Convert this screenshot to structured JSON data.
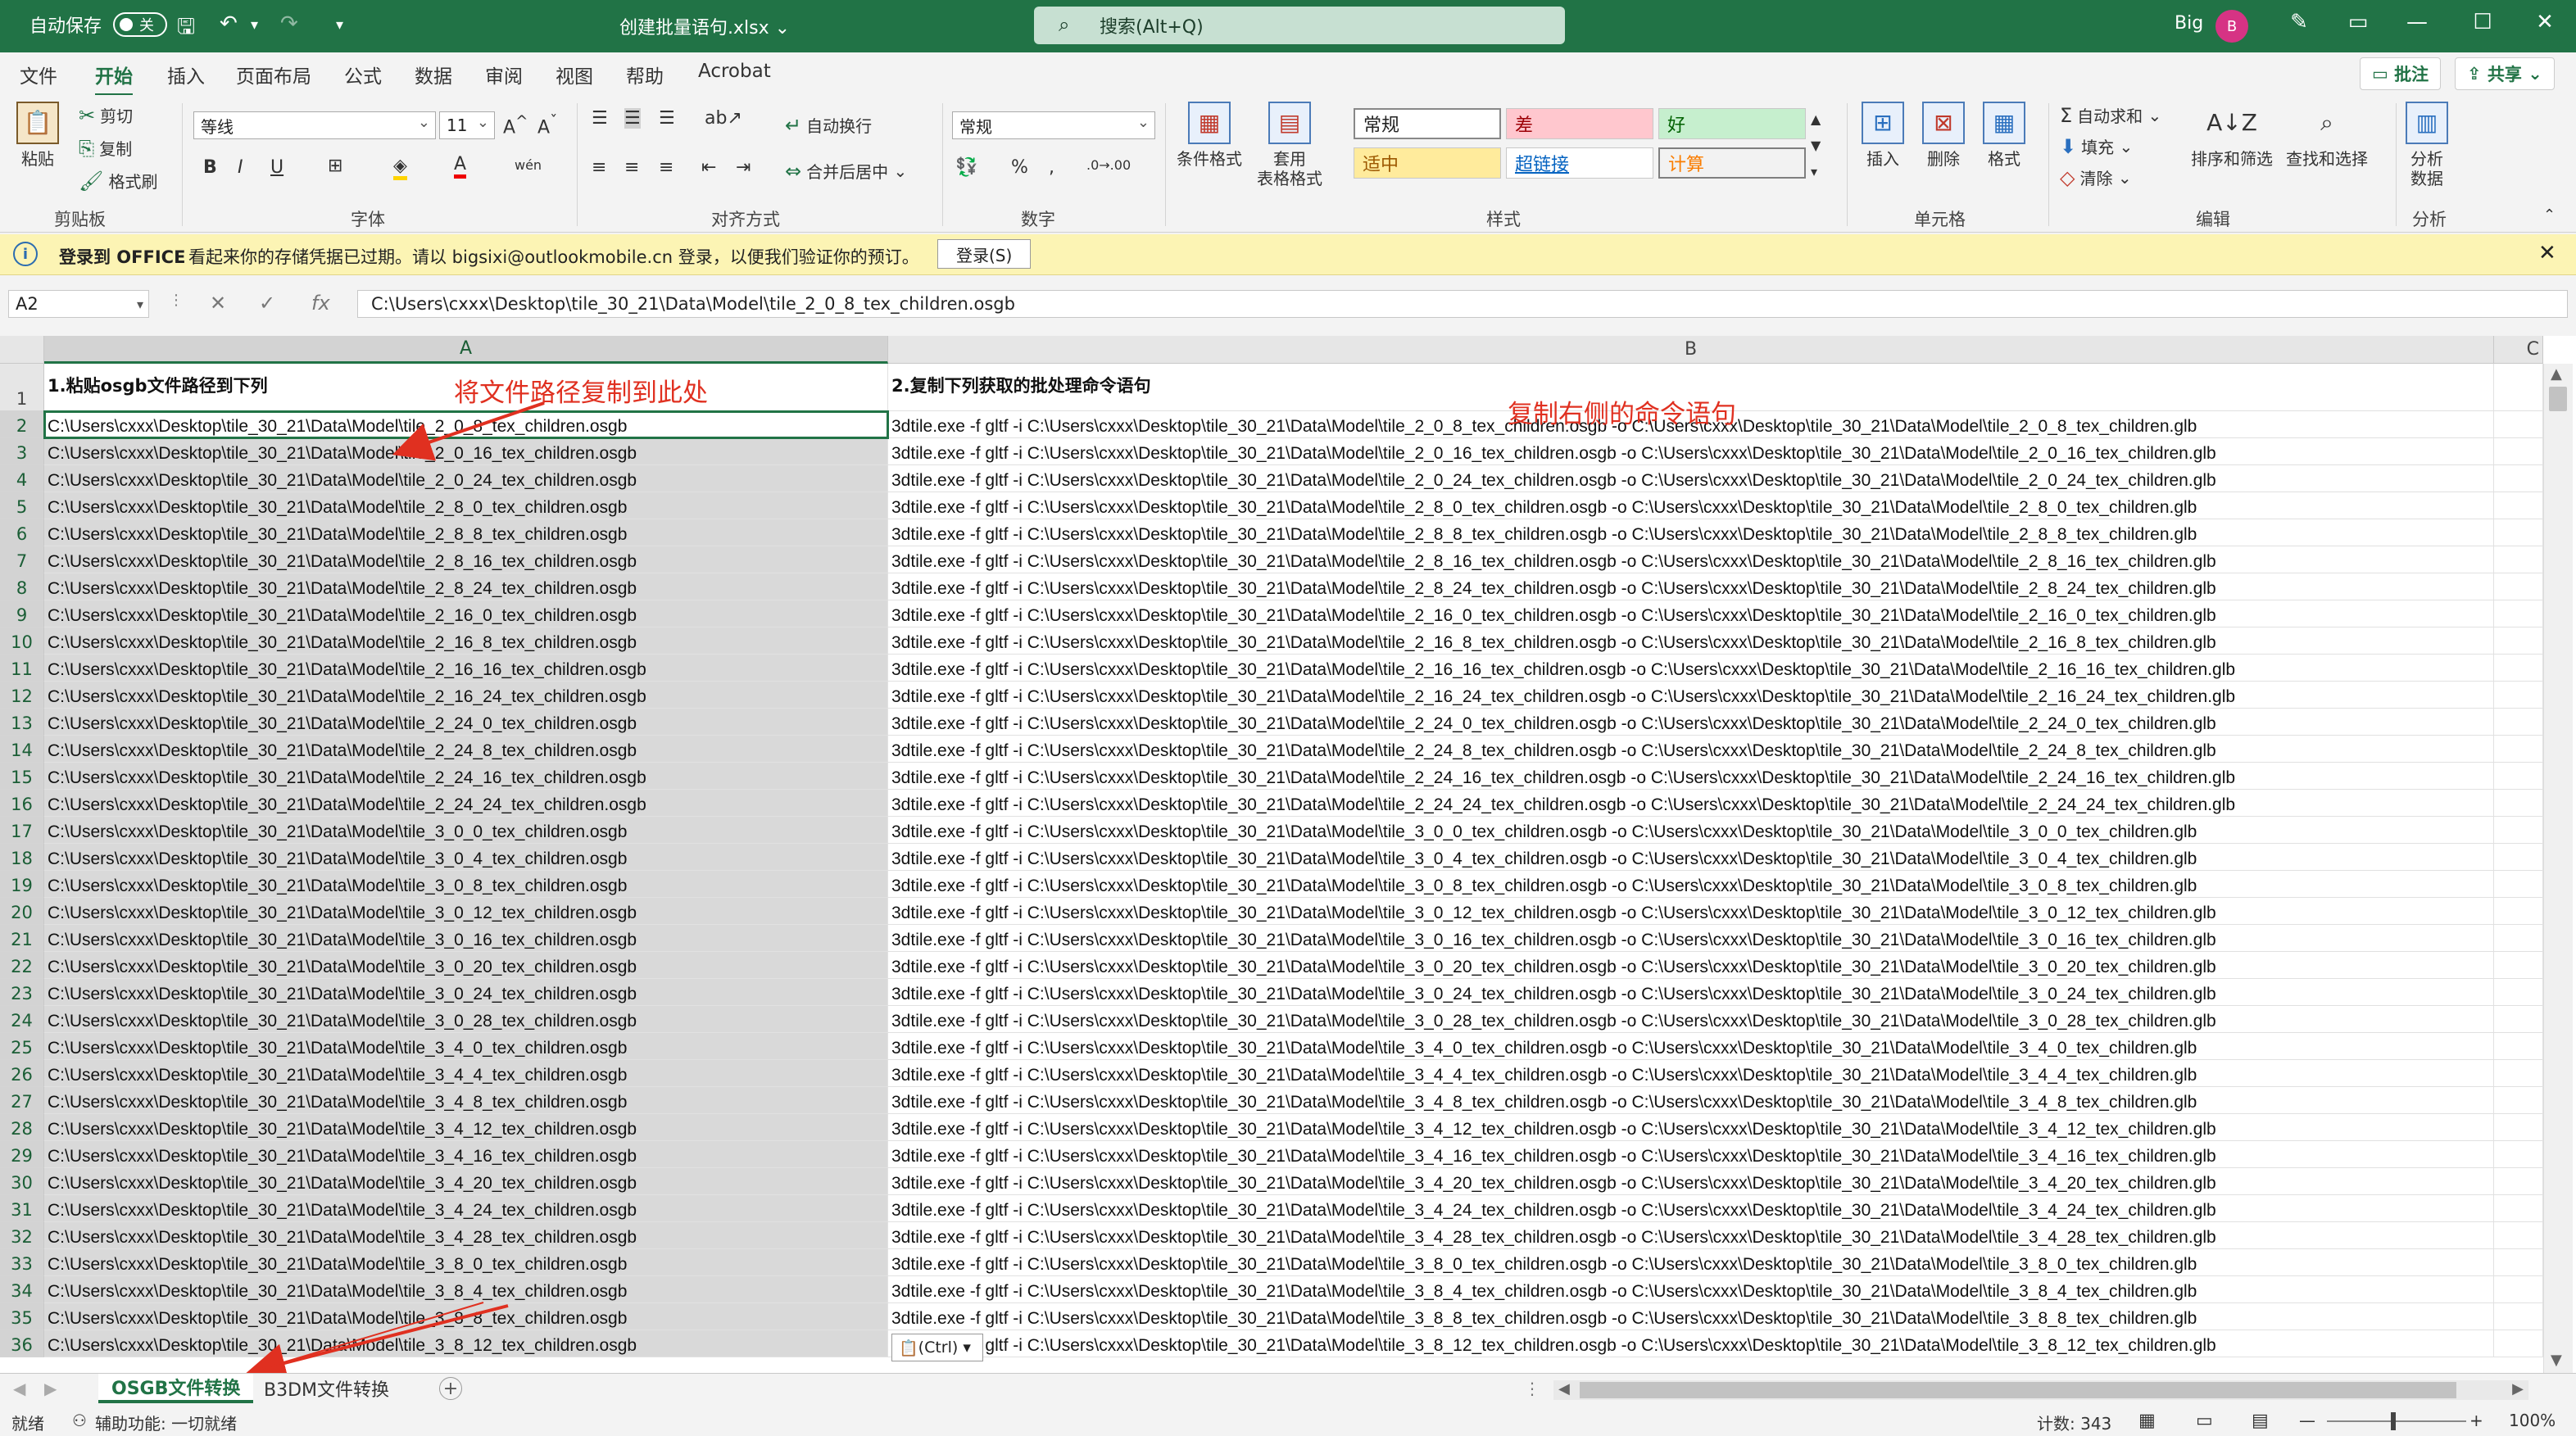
{
  "titlebar": {
    "autosave_label": "自动保存",
    "autosave_state": "关",
    "doc_title": "创建批量语句.xlsx",
    "search_placeholder": "搜索(Alt+Q)",
    "user_name": "Big",
    "avatar_initial": "B"
  },
  "menu": {
    "items": [
      "文件",
      "开始",
      "插入",
      "页面布局",
      "公式",
      "数据",
      "审阅",
      "视图",
      "帮助",
      "Acrobat"
    ],
    "comment_label": "批注",
    "share_label": "共享"
  },
  "ribbon": {
    "clipboard": {
      "paste": "粘贴",
      "cut": "剪切",
      "copy": "复制",
      "format_painter": "格式刷",
      "label": "剪贴板"
    },
    "font": {
      "name": "等线",
      "size": "11",
      "label": "字体",
      "bold": "B",
      "italic": "I",
      "underline": "U"
    },
    "alignment": {
      "wrap": "自动换行",
      "merge": "合并后居中",
      "label": "对齐方式"
    },
    "number": {
      "format": "常规",
      "label": "数字"
    },
    "styles": {
      "conditional": "条件格式",
      "table": "套用\n表格格式",
      "cells": [
        "常规",
        "差",
        "好",
        "适中",
        "超链接",
        "计算"
      ],
      "label": "样式"
    },
    "cells": {
      "insert": "插入",
      "delete": "删除",
      "format": "格式",
      "label": "单元格"
    },
    "editing": {
      "autosum": "自动求和",
      "fill": "填充",
      "clear": "清除",
      "sort": "排序和筛选",
      "find": "查找和选择",
      "label": "编辑"
    },
    "analysis": {
      "analyze": "分析\n数据",
      "label": "分析"
    }
  },
  "message": {
    "title": "登录到 OFFICE",
    "text": "看起来你的存储凭据已过期。请以 bigsixi@outlookmobile.cn 登录，以便我们验证你的预订。",
    "button": "登录(S)"
  },
  "formula_bar": {
    "name_box": "A2",
    "fx": "fx",
    "value": "C:\\Users\\cxxx\\Desktop\\tile_30_21\\Data\\Model\\tile_2_0_8_tex_children.osgb"
  },
  "grid": {
    "columns": [
      "A",
      "B",
      "C"
    ],
    "header_a": "1.粘贴osgb文件路径到下列",
    "header_b": "2.复制下列获取的批处理命令语句",
    "path_prefix": "C:\\Users\\cxxx\\Desktop\\tile_30_21\\Data\\Model\\",
    "tiles": [
      "2_0_8",
      "2_0_16",
      "2_0_24",
      "2_8_0",
      "2_8_8",
      "2_8_16",
      "2_8_24",
      "2_16_0",
      "2_16_8",
      "2_16_16",
      "2_16_24",
      "2_24_0",
      "2_24_8",
      "2_24_16",
      "2_24_24",
      "3_0_0",
      "3_0_4",
      "3_0_8",
      "3_0_12",
      "3_0_16",
      "3_0_20",
      "3_0_24",
      "3_0_28",
      "3_4_0",
      "3_4_4",
      "3_4_8",
      "3_4_12",
      "3_4_16",
      "3_4_20",
      "3_4_24",
      "3_4_28",
      "3_8_0",
      "3_8_4",
      "3_8_8",
      "3_8_12"
    ],
    "rows_a": [
      "C:\\Users\\cxxx\\Desktop\\tile_30_21\\Data\\Model\\tile_2_0_8_tex_children.osgb",
      "C:\\Users\\cxxx\\Desktop\\tile_30_21\\Data\\Model\\tile_2_0_16_tex_children.osgb",
      "C:\\Users\\cxxx\\Desktop\\tile_30_21\\Data\\Model\\tile_2_0_24_tex_children.osgb",
      "C:\\Users\\cxxx\\Desktop\\tile_30_21\\Data\\Model\\tile_2_8_0_tex_children.osgb",
      "C:\\Users\\cxxx\\Desktop\\tile_30_21\\Data\\Model\\tile_2_8_8_tex_children.osgb",
      "C:\\Users\\cxxx\\Desktop\\tile_30_21\\Data\\Model\\tile_2_8_16_tex_children.osgb",
      "C:\\Users\\cxxx\\Desktop\\tile_30_21\\Data\\Model\\tile_2_8_24_tex_children.osgb",
      "C:\\Users\\cxxx\\Desktop\\tile_30_21\\Data\\Model\\tile_2_16_0_tex_children.osgb",
      "C:\\Users\\cxxx\\Desktop\\tile_30_21\\Data\\Model\\tile_2_16_8_tex_children.osgb",
      "C:\\Users\\cxxx\\Desktop\\tile_30_21\\Data\\Model\\tile_2_16_16_tex_children.osgb",
      "C:\\Users\\cxxx\\Desktop\\tile_30_21\\Data\\Model\\tile_2_16_24_tex_children.osgb",
      "C:\\Users\\cxxx\\Desktop\\tile_30_21\\Data\\Model\\tile_2_24_0_tex_children.osgb",
      "C:\\Users\\cxxx\\Desktop\\tile_30_21\\Data\\Model\\tile_2_24_8_tex_children.osgb",
      "C:\\Users\\cxxx\\Desktop\\tile_30_21\\Data\\Model\\tile_2_24_16_tex_children.osgb",
      "C:\\Users\\cxxx\\Desktop\\tile_30_21\\Data\\Model\\tile_2_24_24_tex_children.osgb",
      "C:\\Users\\cxxx\\Desktop\\tile_30_21\\Data\\Model\\tile_3_0_0_tex_children.osgb",
      "C:\\Users\\cxxx\\Desktop\\tile_30_21\\Data\\Model\\tile_3_0_4_tex_children.osgb",
      "C:\\Users\\cxxx\\Desktop\\tile_30_21\\Data\\Model\\tile_3_0_8_tex_children.osgb",
      "C:\\Users\\cxxx\\Desktop\\tile_30_21\\Data\\Model\\tile_3_0_12_tex_children.osgb",
      "C:\\Users\\cxxx\\Desktop\\tile_30_21\\Data\\Model\\tile_3_0_16_tex_children.osgb",
      "C:\\Users\\cxxx\\Desktop\\tile_30_21\\Data\\Model\\tile_3_0_20_tex_children.osgb",
      "C:\\Users\\cxxx\\Desktop\\tile_30_21\\Data\\Model\\tile_3_0_24_tex_children.osgb",
      "C:\\Users\\cxxx\\Desktop\\tile_30_21\\Data\\Model\\tile_3_0_28_tex_children.osgb",
      "C:\\Users\\cxxx\\Desktop\\tile_30_21\\Data\\Model\\tile_3_4_0_tex_children.osgb",
      "C:\\Users\\cxxx\\Desktop\\tile_30_21\\Data\\Model\\tile_3_4_4_tex_children.osgb",
      "C:\\Users\\cxxx\\Desktop\\tile_30_21\\Data\\Model\\tile_3_4_8_tex_children.osgb",
      "C:\\Users\\cxxx\\Desktop\\tile_30_21\\Data\\Model\\tile_3_4_12_tex_children.osgb",
      "C:\\Users\\cxxx\\Desktop\\tile_30_21\\Data\\Model\\tile_3_4_16_tex_children.osgb",
      "C:\\Users\\cxxx\\Desktop\\tile_30_21\\Data\\Model\\tile_3_4_20_tex_children.osgb",
      "C:\\Users\\cxxx\\Desktop\\tile_30_21\\Data\\Model\\tile_3_4_24_tex_children.osgb",
      "C:\\Users\\cxxx\\Desktop\\tile_30_21\\Data\\Model\\tile_3_4_28_tex_children.osgb",
      "C:\\Users\\cxxx\\Desktop\\tile_30_21\\Data\\Model\\tile_3_8_0_tex_children.osgb",
      "C:\\Users\\cxxx\\Desktop\\tile_30_21\\Data\\Model\\tile_3_8_4_tex_children.osgb",
      "C:\\Users\\cxxx\\Desktop\\tile_30_21\\Data\\Model\\tile_3_8_8_tex_children.osgb",
      "C:\\Users\\cxxx\\Desktop\\tile_30_21\\Data\\Model\\tile_3_8_12_tex_children.osgb"
    ],
    "rows_b": [
      "3dtile.exe -f gltf -i C:\\Users\\cxxx\\Desktop\\tile_30_21\\Data\\Model\\tile_2_0_8_tex_children.osgb -o C:\\Users\\cxxx\\Desktop\\tile_30_21\\Data\\Model\\tile_2_0_8_tex_children.glb",
      "3dtile.exe -f gltf -i C:\\Users\\cxxx\\Desktop\\tile_30_21\\Data\\Model\\tile_2_0_16_tex_children.osgb -o C:\\Users\\cxxx\\Desktop\\tile_30_21\\Data\\Model\\tile_2_0_16_tex_children.glb",
      "3dtile.exe -f gltf -i C:\\Users\\cxxx\\Desktop\\tile_30_21\\Data\\Model\\tile_2_0_24_tex_children.osgb -o C:\\Users\\cxxx\\Desktop\\tile_30_21\\Data\\Model\\tile_2_0_24_tex_children.glb",
      "3dtile.exe -f gltf -i C:\\Users\\cxxx\\Desktop\\tile_30_21\\Data\\Model\\tile_2_8_0_tex_children.osgb -o C:\\Users\\cxxx\\Desktop\\tile_30_21\\Data\\Model\\tile_2_8_0_tex_children.glb",
      "3dtile.exe -f gltf -i C:\\Users\\cxxx\\Desktop\\tile_30_21\\Data\\Model\\tile_2_8_8_tex_children.osgb -o C:\\Users\\cxxx\\Desktop\\tile_30_21\\Data\\Model\\tile_2_8_8_tex_children.glb",
      "3dtile.exe -f gltf -i C:\\Users\\cxxx\\Desktop\\tile_30_21\\Data\\Model\\tile_2_8_16_tex_children.osgb -o C:\\Users\\cxxx\\Desktop\\tile_30_21\\Data\\Model\\tile_2_8_16_tex_children.glb",
      "3dtile.exe -f gltf -i C:\\Users\\cxxx\\Desktop\\tile_30_21\\Data\\Model\\tile_2_8_24_tex_children.osgb -o C:\\Users\\cxxx\\Desktop\\tile_30_21\\Data\\Model\\tile_2_8_24_tex_children.glb",
      "3dtile.exe -f gltf -i C:\\Users\\cxxx\\Desktop\\tile_30_21\\Data\\Model\\tile_2_16_0_tex_children.osgb -o C:\\Users\\cxxx\\Desktop\\tile_30_21\\Data\\Model\\tile_2_16_0_tex_children.glb",
      "3dtile.exe -f gltf -i C:\\Users\\cxxx\\Desktop\\tile_30_21\\Data\\Model\\tile_2_16_8_tex_children.osgb -o C:\\Users\\cxxx\\Desktop\\tile_30_21\\Data\\Model\\tile_2_16_8_tex_children.glb",
      "3dtile.exe -f gltf -i C:\\Users\\cxxx\\Desktop\\tile_30_21\\Data\\Model\\tile_2_16_16_tex_children.osgb -o C:\\Users\\cxxx\\Desktop\\tile_30_21\\Data\\Model\\tile_2_16_16_tex_children.glb",
      "3dtile.exe -f gltf -i C:\\Users\\cxxx\\Desktop\\tile_30_21\\Data\\Model\\tile_2_16_24_tex_children.osgb -o C:\\Users\\cxxx\\Desktop\\tile_30_21\\Data\\Model\\tile_2_16_24_tex_children.glb",
      "3dtile.exe -f gltf -i C:\\Users\\cxxx\\Desktop\\tile_30_21\\Data\\Model\\tile_2_24_0_tex_children.osgb -o C:\\Users\\cxxx\\Desktop\\tile_30_21\\Data\\Model\\tile_2_24_0_tex_children.glb",
      "3dtile.exe -f gltf -i C:\\Users\\cxxx\\Desktop\\tile_30_21\\Data\\Model\\tile_2_24_8_tex_children.osgb -o C:\\Users\\cxxx\\Desktop\\tile_30_21\\Data\\Model\\tile_2_24_8_tex_children.glb",
      "3dtile.exe -f gltf -i C:\\Users\\cxxx\\Desktop\\tile_30_21\\Data\\Model\\tile_2_24_16_tex_children.osgb -o C:\\Users\\cxxx\\Desktop\\tile_30_21\\Data\\Model\\tile_2_24_16_tex_children.glb",
      "3dtile.exe -f gltf -i C:\\Users\\cxxx\\Desktop\\tile_30_21\\Data\\Model\\tile_2_24_24_tex_children.osgb -o C:\\Users\\cxxx\\Desktop\\tile_30_21\\Data\\Model\\tile_2_24_24_tex_children.glb",
      "3dtile.exe -f gltf -i C:\\Users\\cxxx\\Desktop\\tile_30_21\\Data\\Model\\tile_3_0_0_tex_children.osgb -o C:\\Users\\cxxx\\Desktop\\tile_30_21\\Data\\Model\\tile_3_0_0_tex_children.glb",
      "3dtile.exe -f gltf -i C:\\Users\\cxxx\\Desktop\\tile_30_21\\Data\\Model\\tile_3_0_4_tex_children.osgb -o C:\\Users\\cxxx\\Desktop\\tile_30_21\\Data\\Model\\tile_3_0_4_tex_children.glb",
      "3dtile.exe -f gltf -i C:\\Users\\cxxx\\Desktop\\tile_30_21\\Data\\Model\\tile_3_0_8_tex_children.osgb -o C:\\Users\\cxxx\\Desktop\\tile_30_21\\Data\\Model\\tile_3_0_8_tex_children.glb",
      "3dtile.exe -f gltf -i C:\\Users\\cxxx\\Desktop\\tile_30_21\\Data\\Model\\tile_3_0_12_tex_children.osgb -o C:\\Users\\cxxx\\Desktop\\tile_30_21\\Data\\Model\\tile_3_0_12_tex_children.glb",
      "3dtile.exe -f gltf -i C:\\Users\\cxxx\\Desktop\\tile_30_21\\Data\\Model\\tile_3_0_16_tex_children.osgb -o C:\\Users\\cxxx\\Desktop\\tile_30_21\\Data\\Model\\tile_3_0_16_tex_children.glb",
      "3dtile.exe -f gltf -i C:\\Users\\cxxx\\Desktop\\tile_30_21\\Data\\Model\\tile_3_0_20_tex_children.osgb -o C:\\Users\\cxxx\\Desktop\\tile_30_21\\Data\\Model\\tile_3_0_20_tex_children.glb",
      "3dtile.exe -f gltf -i C:\\Users\\cxxx\\Desktop\\tile_30_21\\Data\\Model\\tile_3_0_24_tex_children.osgb -o C:\\Users\\cxxx\\Desktop\\tile_30_21\\Data\\Model\\tile_3_0_24_tex_children.glb",
      "3dtile.exe -f gltf -i C:\\Users\\cxxx\\Desktop\\tile_30_21\\Data\\Model\\tile_3_0_28_tex_children.osgb -o C:\\Users\\cxxx\\Desktop\\tile_30_21\\Data\\Model\\tile_3_0_28_tex_children.glb",
      "3dtile.exe -f gltf -i C:\\Users\\cxxx\\Desktop\\tile_30_21\\Data\\Model\\tile_3_4_0_tex_children.osgb -o C:\\Users\\cxxx\\Desktop\\tile_30_21\\Data\\Model\\tile_3_4_0_tex_children.glb",
      "3dtile.exe -f gltf -i C:\\Users\\cxxx\\Desktop\\tile_30_21\\Data\\Model\\tile_3_4_4_tex_children.osgb -o C:\\Users\\cxxx\\Desktop\\tile_30_21\\Data\\Model\\tile_3_4_4_tex_children.glb",
      "3dtile.exe -f gltf -i C:\\Users\\cxxx\\Desktop\\tile_30_21\\Data\\Model\\tile_3_4_8_tex_children.osgb -o C:\\Users\\cxxx\\Desktop\\tile_30_21\\Data\\Model\\tile_3_4_8_tex_children.glb",
      "3dtile.exe -f gltf -i C:\\Users\\cxxx\\Desktop\\tile_30_21\\Data\\Model\\tile_3_4_12_tex_children.osgb -o C:\\Users\\cxxx\\Desktop\\tile_30_21\\Data\\Model\\tile_3_4_12_tex_children.glb",
      "3dtile.exe -f gltf -i C:\\Users\\cxxx\\Desktop\\tile_30_21\\Data\\Model\\tile_3_4_16_tex_children.osgb -o C:\\Users\\cxxx\\Desktop\\tile_30_21\\Data\\Model\\tile_3_4_16_tex_children.glb",
      "3dtile.exe -f gltf -i C:\\Users\\cxxx\\Desktop\\tile_30_21\\Data\\Model\\tile_3_4_20_tex_children.osgb -o C:\\Users\\cxxx\\Desktop\\tile_30_21\\Data\\Model\\tile_3_4_20_tex_children.glb",
      "3dtile.exe -f gltf -i C:\\Users\\cxxx\\Desktop\\tile_30_21\\Data\\Model\\tile_3_4_24_tex_children.osgb -o C:\\Users\\cxxx\\Desktop\\tile_30_21\\Data\\Model\\tile_3_4_24_tex_children.glb",
      "3dtile.exe -f gltf -i C:\\Users\\cxxx\\Desktop\\tile_30_21\\Data\\Model\\tile_3_4_28_tex_children.osgb -o C:\\Users\\cxxx\\Desktop\\tile_30_21\\Data\\Model\\tile_3_4_28_tex_children.glb",
      "3dtile.exe -f gltf -i C:\\Users\\cxxx\\Desktop\\tile_30_21\\Data\\Model\\tile_3_8_0_tex_children.osgb -o C:\\Users\\cxxx\\Desktop\\tile_30_21\\Data\\Model\\tile_3_8_0_tex_children.glb",
      "3dtile.exe -f gltf -i C:\\Users\\cxxx\\Desktop\\tile_30_21\\Data\\Model\\tile_3_8_4_tex_children.osgb -o C:\\Users\\cxxx\\Desktop\\tile_30_21\\Data\\Model\\tile_3_8_4_tex_children.glb",
      "3dtile.exe -f gltf -i C:\\Users\\cxxx\\Desktop\\tile_30_21\\Data\\Model\\tile_3_8_8_tex_children.osgb -o C:\\Users\\cxxx\\Desktop\\tile_30_21\\Data\\Model\\tile_3_8_8_tex_children.glb",
      "3dtile.exe -f gltf -i C:\\Users\\cxxx\\Desktop\\tile_30_21\\Data\\Model\\tile_3_8_12_tex_children.osgb -o C:\\Users\\cxxx\\Desktop\\tile_30_21\\Data\\Model\\tile_3_8_12_tex_children.glb"
    ],
    "paste_options": "(Ctrl)"
  },
  "annotations": {
    "copy_path_here": "将文件路径复制到此处",
    "copy_right_command": "复制右侧的命令语句"
  },
  "sheets": {
    "tabs": [
      "OSGB文件转换",
      "B3DM文件转换"
    ],
    "active": "OSGB文件转换"
  },
  "status": {
    "ready": "就绪",
    "accessibility": "辅助功能: 一切就绪",
    "count": "计数: 343",
    "zoom": "100%"
  },
  "colors": {
    "excel_green": "#217346",
    "annotation_red": "#e03020",
    "message_bar": "#fcf4b4"
  }
}
